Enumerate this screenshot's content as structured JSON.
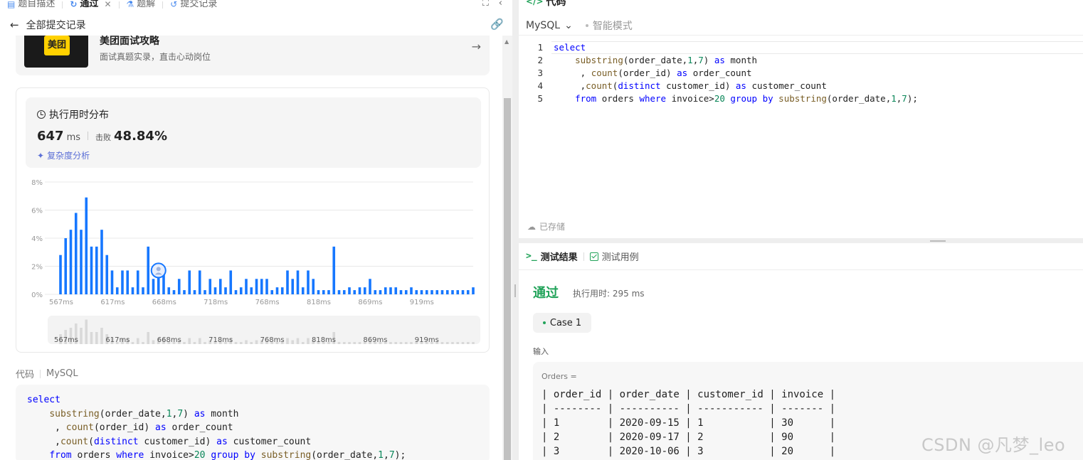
{
  "tabs": [
    {
      "label": "题目描述",
      "icon": "document-icon"
    },
    {
      "label": "通过",
      "icon": "check-history-icon",
      "active": true
    },
    {
      "label": "题解",
      "icon": "flask-icon"
    },
    {
      "label": "提交记录",
      "icon": "history-icon"
    }
  ],
  "header": {
    "back_label": "全部提交记录"
  },
  "promo": {
    "logo_text": "美团",
    "title": "美团面试攻略",
    "subtitle": "面试真题实录，直击心动岗位"
  },
  "runtime": {
    "title": "执行用时分布",
    "value": "647",
    "unit": "ms",
    "beats_label": "击败",
    "beats_value": "48.84%",
    "analysis_label": "复杂度分析"
  },
  "chart_data": {
    "type": "bar",
    "yticks": [
      "8%",
      "6%",
      "4%",
      "2%",
      "0%"
    ],
    "ylim": [
      0,
      8
    ],
    "xticks": [
      "567ms",
      "617ms",
      "668ms",
      "718ms",
      "768ms",
      "818ms",
      "869ms",
      "919ms"
    ],
    "values": [
      2.8,
      4.0,
      4.6,
      5.8,
      4.6,
      6.9,
      3.4,
      3.4,
      4.6,
      2.8,
      1.7,
      0.5,
      1.7,
      1.7,
      0.5,
      1.7,
      0.5,
      3.4,
      1.1,
      1.7,
      1.7,
      0.5,
      0.3,
      1.1,
      0.3,
      1.7,
      0.3,
      1.7,
      0.3,
      1.1,
      0.5,
      1.1,
      0.5,
      1.7,
      0.3,
      0.5,
      1.1,
      0.5,
      1.1,
      1.1,
      1.1,
      0.3,
      0.5,
      0.5,
      1.7,
      1.1,
      1.7,
      0.5,
      1.7,
      1.1,
      0.3,
      0.3,
      0.3,
      3.4,
      0.3,
      0.3,
      0.5,
      0.3,
      0.5,
      0.5,
      1.1,
      0.3,
      0.3,
      0.5,
      0.5,
      0.5,
      0.3,
      0.3,
      0.5,
      0.3,
      0.3,
      0.3,
      0.3,
      0.3,
      0.3,
      0.3,
      0.3,
      0.3,
      0.3,
      0.3,
      0.5
    ],
    "highlight_index": 19,
    "colors": {
      "bar": "#1677ff",
      "mini": "#d9d9d9",
      "grid": "#e8e8e8"
    }
  },
  "code_section": {
    "label": "代码",
    "lang": "MySQL"
  },
  "code_lines": [
    "select",
    "    substring(order_date,1,7) as month",
    "     , count(order_id) as order_count",
    "     ,count(distinct customer_id) as customer_count",
    "    from orders where invoice>20 group by substring(order_date,1,7);"
  ],
  "editor": {
    "title": "代码",
    "lang": "MySQL",
    "mode": "智能模式",
    "saved": "已存储",
    "line_numbers": [
      "1",
      "2",
      "3",
      "4",
      "5"
    ]
  },
  "result_tabs": {
    "result": "测试结果",
    "cases": "测试用例"
  },
  "result": {
    "status": "通过",
    "exec_time": "执行用时: 295 ms",
    "case": "Case 1",
    "input_label": "输入",
    "var": "Orders =",
    "table_lines": [
      "| order_id | order_date | customer_id | invoice |",
      "| -------- | ---------- | ----------- | ------- |",
      "| 1        | 2020-09-15 | 1           | 30      |",
      "| 2        | 2020-09-17 | 2           | 90      |",
      "| 3        | 2020-10-06 | 3           | 20      |"
    ]
  },
  "watermark": "CSDN @凡梦_leo"
}
